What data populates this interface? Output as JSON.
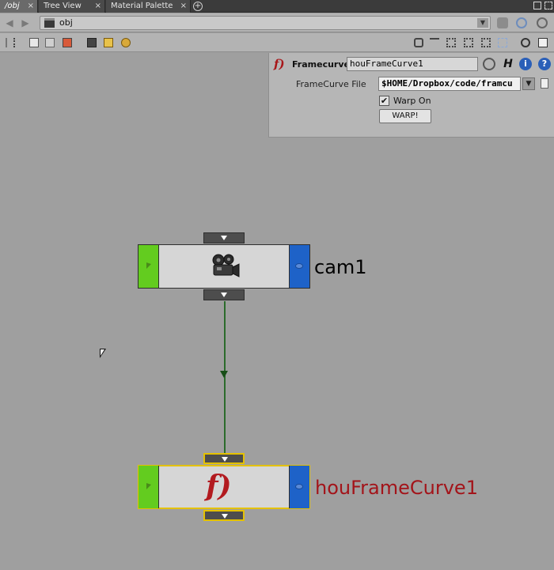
{
  "tabs": [
    {
      "label": "/obj",
      "active": true
    },
    {
      "label": "Tree View",
      "active": false
    },
    {
      "label": "Material Palette",
      "active": false
    }
  ],
  "path": {
    "value": "obj"
  },
  "params": {
    "node_type": "Framecurve",
    "node_name": "houFrameCurve1",
    "file_label": "FrameCurve File",
    "file_value": "$HOME/Dropbox/code/framcu",
    "warp_label": "Warp On",
    "warp_checked": true,
    "warp_button": "WARP!",
    "h_glyph": "H",
    "info_glyph": "i",
    "help_glyph": "?"
  },
  "nodes": [
    {
      "name": "cam1",
      "icon": "camera-icon",
      "selected": false,
      "label_color": "#000000"
    },
    {
      "name": "houFrameCurve1",
      "icon": "framecurve-icon",
      "selected": true,
      "label_color": "#a3141a"
    }
  ],
  "icons": {
    "fx_glyph": "f)"
  },
  "colors": {
    "bypass_green": "#63cc1f",
    "display_blue": "#1e62c8",
    "selection_yellow": "#e4c100",
    "wire": "#2b6b2b",
    "framecurve_red": "#a3141a"
  }
}
